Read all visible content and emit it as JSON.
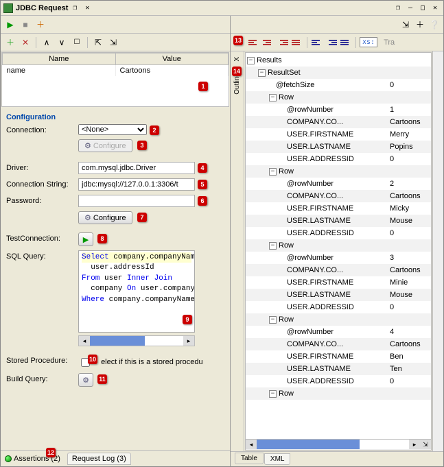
{
  "titlebar": {
    "title": "JDBC Request"
  },
  "grid": {
    "headers": {
      "name": "Name",
      "value": "Value"
    },
    "rows": [
      {
        "name": "name",
        "value": "Cartoons"
      }
    ]
  },
  "config": {
    "title": "Configuration",
    "labels": {
      "connection": "Connection:",
      "driver": "Driver:",
      "connstr": "Connection String:",
      "password": "Password:",
      "testconn": "TestConnection:",
      "sqlquery": "SQL Query:",
      "storedproc": "Stored Procedure:",
      "buildquery": "Build Query:"
    },
    "connection_value": "<None>",
    "configure_btn": "Configure",
    "configure_btn2": "Configure",
    "driver_value": "com.mysql.jdbc.Driver",
    "connstr_value": "jdbc:mysql://127.0.0.1:3306/t",
    "password_value": "",
    "sql_text": "Select company.companyNam\n  user.addressId\nFrom user Inner Join\n  company On user.company\nWhere company.companyName",
    "storedproc_text": "elect if this is a stored procedu"
  },
  "bottom_tabs": {
    "assertions": "Assertions (2)",
    "request_log": "Request Log (3)"
  },
  "right": {
    "vert_tabs": {
      "outline": "Outline",
      "xml": "X"
    },
    "toolbar2_xs": "xs:",
    "toolbar2_tra": "Tra",
    "tree": {
      "root": "Results",
      "resultset": "ResultSet",
      "fetchsize_k": "@fetchSize",
      "fetchsize_v": "0",
      "row_label": "Row",
      "rows": [
        {
          "@rowNumber": "1",
          "COMPANY.CO...": "Cartoons",
          "USER.FIRSTNAME": "Merry",
          "USER.LASTNAME": "Popins",
          "USER.ADDRESSID": "0"
        },
        {
          "@rowNumber": "2",
          "COMPANY.CO...": "Cartoons",
          "USER.FIRSTNAME": "Micky",
          "USER.LASTNAME": "Mouse",
          "USER.ADDRESSID": "0"
        },
        {
          "@rowNumber": "3",
          "COMPANY.CO...": "Cartoons",
          "USER.FIRSTNAME": "Minie",
          "USER.LASTNAME": "Mouse",
          "USER.ADDRESSID": "0"
        },
        {
          "@rowNumber": "4",
          "COMPANY.CO...": "Cartoons",
          "USER.FIRSTNAME": "Ben",
          "USER.LASTNAME": "Ten",
          "USER.ADDRESSID": "0"
        }
      ]
    },
    "bottom_tabs": {
      "table": "Table",
      "xml": "XML"
    }
  },
  "callouts": [
    "1",
    "2",
    "3",
    "4",
    "5",
    "6",
    "7",
    "8",
    "9",
    "10",
    "11",
    "12",
    "13",
    "14"
  ]
}
